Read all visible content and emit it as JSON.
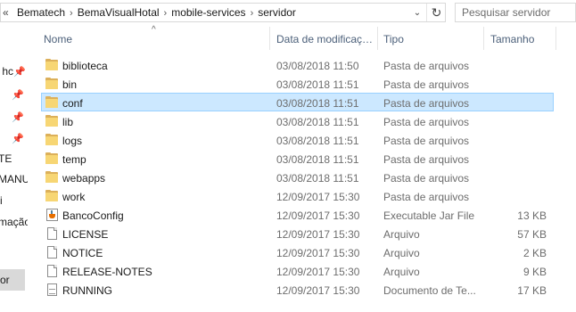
{
  "address": {
    "crumbs": [
      "Bematech",
      "BemaVisualHotal",
      "mobile-services",
      "servidor"
    ],
    "back_chevron": "«",
    "separator": "›",
    "dropdown_glyph": "⌄",
    "refresh_glyph": "↻"
  },
  "search": {
    "placeholder": "Pesquisar servidor"
  },
  "nav": {
    "items": [
      "hc",
      "",
      "",
      "",
      "TE",
      "MANU",
      "i",
      "rmação"
    ],
    "selected_label": "or"
  },
  "columns": {
    "name": "Nome",
    "date": "Data de modificaç…",
    "type": "Tipo",
    "size": "Tamanho",
    "sort_arrow": "^"
  },
  "files": [
    {
      "name": "biblioteca",
      "date": "03/08/2018 11:50",
      "type": "Pasta de arquivos",
      "size": "",
      "icon": "folder-icon",
      "selected": false
    },
    {
      "name": "bin",
      "date": "03/08/2018 11:51",
      "type": "Pasta de arquivos",
      "size": "",
      "icon": "folder-icon",
      "selected": false
    },
    {
      "name": "conf",
      "date": "03/08/2018 11:51",
      "type": "Pasta de arquivos",
      "size": "",
      "icon": "folder-icon",
      "selected": true
    },
    {
      "name": "lib",
      "date": "03/08/2018 11:51",
      "type": "Pasta de arquivos",
      "size": "",
      "icon": "folder-icon",
      "selected": false
    },
    {
      "name": "logs",
      "date": "03/08/2018 11:51",
      "type": "Pasta de arquivos",
      "size": "",
      "icon": "folder-icon",
      "selected": false
    },
    {
      "name": "temp",
      "date": "03/08/2018 11:51",
      "type": "Pasta de arquivos",
      "size": "",
      "icon": "folder-icon",
      "selected": false
    },
    {
      "name": "webapps",
      "date": "03/08/2018 11:51",
      "type": "Pasta de arquivos",
      "size": "",
      "icon": "folder-icon",
      "selected": false
    },
    {
      "name": "work",
      "date": "12/09/2017 15:30",
      "type": "Pasta de arquivos",
      "size": "",
      "icon": "folder-icon",
      "selected": false
    },
    {
      "name": "BancoConfig",
      "date": "12/09/2017 15:30",
      "type": "Executable Jar File",
      "size": "13 KB",
      "icon": "jar-file-icon",
      "selected": false
    },
    {
      "name": "LICENSE",
      "date": "12/09/2017 15:30",
      "type": "Arquivo",
      "size": "57 KB",
      "icon": "file-icon",
      "selected": false
    },
    {
      "name": "NOTICE",
      "date": "12/09/2017 15:30",
      "type": "Arquivo",
      "size": "2 KB",
      "icon": "file-icon",
      "selected": false
    },
    {
      "name": "RELEASE-NOTES",
      "date": "12/09/2017 15:30",
      "type": "Arquivo",
      "size": "9 KB",
      "icon": "file-icon",
      "selected": false
    },
    {
      "name": "RUNNING",
      "date": "12/09/2017 15:30",
      "type": "Documento de Te...",
      "size": "17 KB",
      "icon": "text-file-icon",
      "selected": false
    }
  ],
  "colors": {
    "selection_bg": "#cce8ff",
    "selection_border": "#99d1ff",
    "folder": "#f7d674",
    "header_text": "#4c607a"
  }
}
